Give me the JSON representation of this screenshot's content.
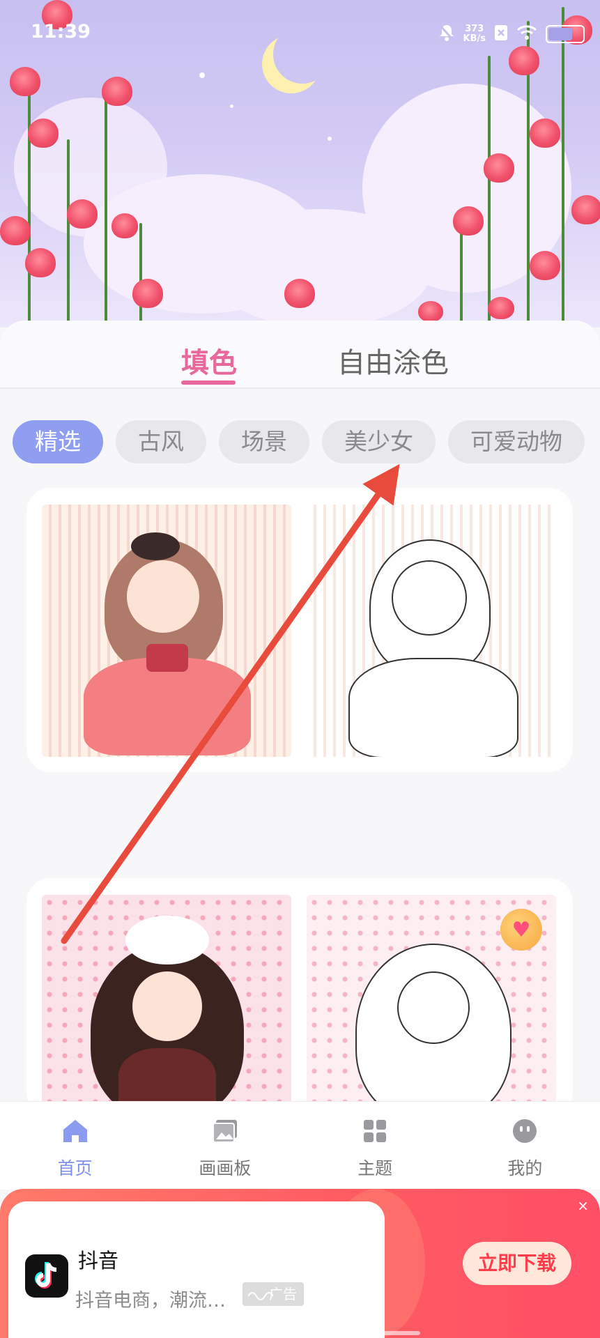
{
  "status_bar": {
    "time": "11:39",
    "net_speed_value": "373",
    "net_speed_unit": "KB/s",
    "icons": [
      "bell-mute-icon",
      "sim-blocked-icon",
      "wifi-icon",
      "battery-icon"
    ]
  },
  "mode_tabs": [
    {
      "label": "填色",
      "active": true
    },
    {
      "label": "自由涂色",
      "active": false
    }
  ],
  "categories": [
    {
      "label": "精选",
      "active": true
    },
    {
      "label": "古风",
      "active": false
    },
    {
      "label": "场景",
      "active": false
    },
    {
      "label": "美少女",
      "active": false
    },
    {
      "label": "可爱动物",
      "active": false
    }
  ],
  "bottom_nav": [
    {
      "label": "首页",
      "icon": "home-icon",
      "active": true
    },
    {
      "label": "画画板",
      "icon": "gallery-icon",
      "active": false
    },
    {
      "label": "主题",
      "icon": "grid-icon",
      "active": false
    },
    {
      "label": "我的",
      "icon": "face-icon",
      "active": false
    }
  ],
  "ad": {
    "app_name": "抖音",
    "description": "抖音电商，潮流…",
    "tag": "广告",
    "cta": "立即下载",
    "close": "×"
  },
  "colors": {
    "accent_pink": "#e8679c",
    "chip_active": "#8f9ef0",
    "nav_active": "#7f8fe8",
    "ad_red": "#ff5a62"
  }
}
